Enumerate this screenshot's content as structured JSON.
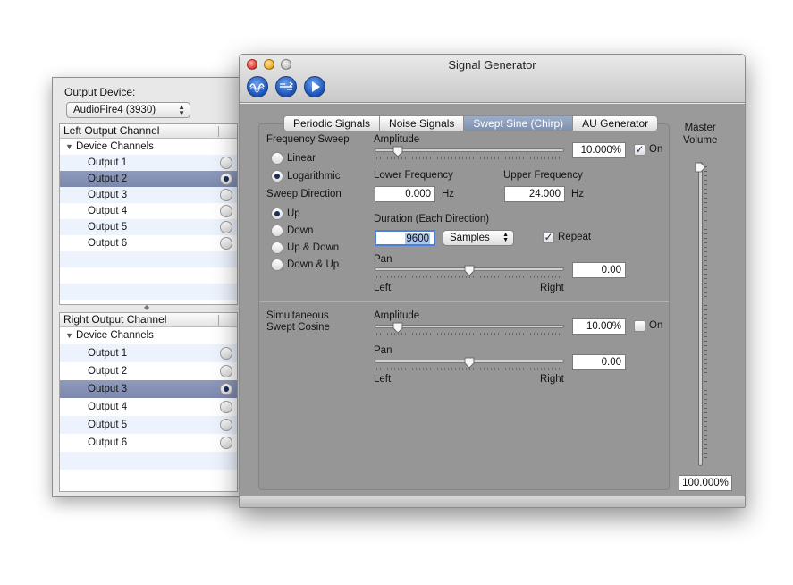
{
  "drawer": {
    "output_device_label": "Output Device:",
    "output_device_value": "AudioFire4 (3930)",
    "left": {
      "header": "Left Output Channel",
      "group": "Device Channels",
      "items": [
        "Output 1",
        "Output 2",
        "Output 3",
        "Output 4",
        "Output 5",
        "Output 6"
      ],
      "selected_index": 1
    },
    "right": {
      "header": "Right Output Channel",
      "group": "Device Channels",
      "items": [
        "Output 1",
        "Output 2",
        "Output 3",
        "Output 4",
        "Output 5",
        "Output 6"
      ],
      "selected_index": 2
    }
  },
  "window": {
    "title": "Signal Generator",
    "toolbar_icons": [
      "waveform-icon",
      "sweep-icon",
      "play-icon"
    ]
  },
  "tabs": [
    {
      "label": "Periodic Signals",
      "active": false
    },
    {
      "label": "Noise Signals",
      "active": false
    },
    {
      "label": "Swept Sine (Chirp)",
      "active": true
    },
    {
      "label": "AU Generator",
      "active": false
    }
  ],
  "sweep": {
    "frequency_sweep_label": "Frequency Sweep",
    "linear_label": "Linear",
    "logarithmic_label": "Logarithmic",
    "frequency_mode": "Logarithmic",
    "sweep_direction_label": "Sweep Direction",
    "direction_options": [
      "Up",
      "Down",
      "Up & Down",
      "Down & Up"
    ],
    "direction_selected": "Up",
    "amplitude_label": "Amplitude",
    "amplitude_value": "10.000%",
    "amplitude_level": 0.1,
    "on_label": "On",
    "on_checked": true,
    "lower_frequency_label": "Lower Frequency",
    "lower_frequency_value": "0.000",
    "upper_frequency_label": "Upper Frequency",
    "upper_frequency_value": "24.000",
    "hz_unit": "Hz",
    "duration_label": "Duration (Each Direction)",
    "duration_value": "9600",
    "duration_unit": "Samples",
    "repeat_label": "Repeat",
    "repeat_checked": true,
    "pan_label": "Pan",
    "pan_value": "0.00",
    "pan_level": 0.5,
    "left_label": "Left",
    "right_label": "Right"
  },
  "cosine": {
    "label_line1": "Simultaneous",
    "label_line2": "Swept Cosine",
    "amplitude_label": "Amplitude",
    "amplitude_value": "10.00%",
    "amplitude_level": 0.1,
    "on_label": "On",
    "on_checked": false,
    "pan_label": "Pan",
    "pan_value": "0.00",
    "pan_level": 0.5,
    "left_label": "Left",
    "right_label": "Right"
  },
  "master_volume": {
    "label_line1": "Master",
    "label_line2": "Volume",
    "value": "100.000%",
    "level": 1.0
  }
}
